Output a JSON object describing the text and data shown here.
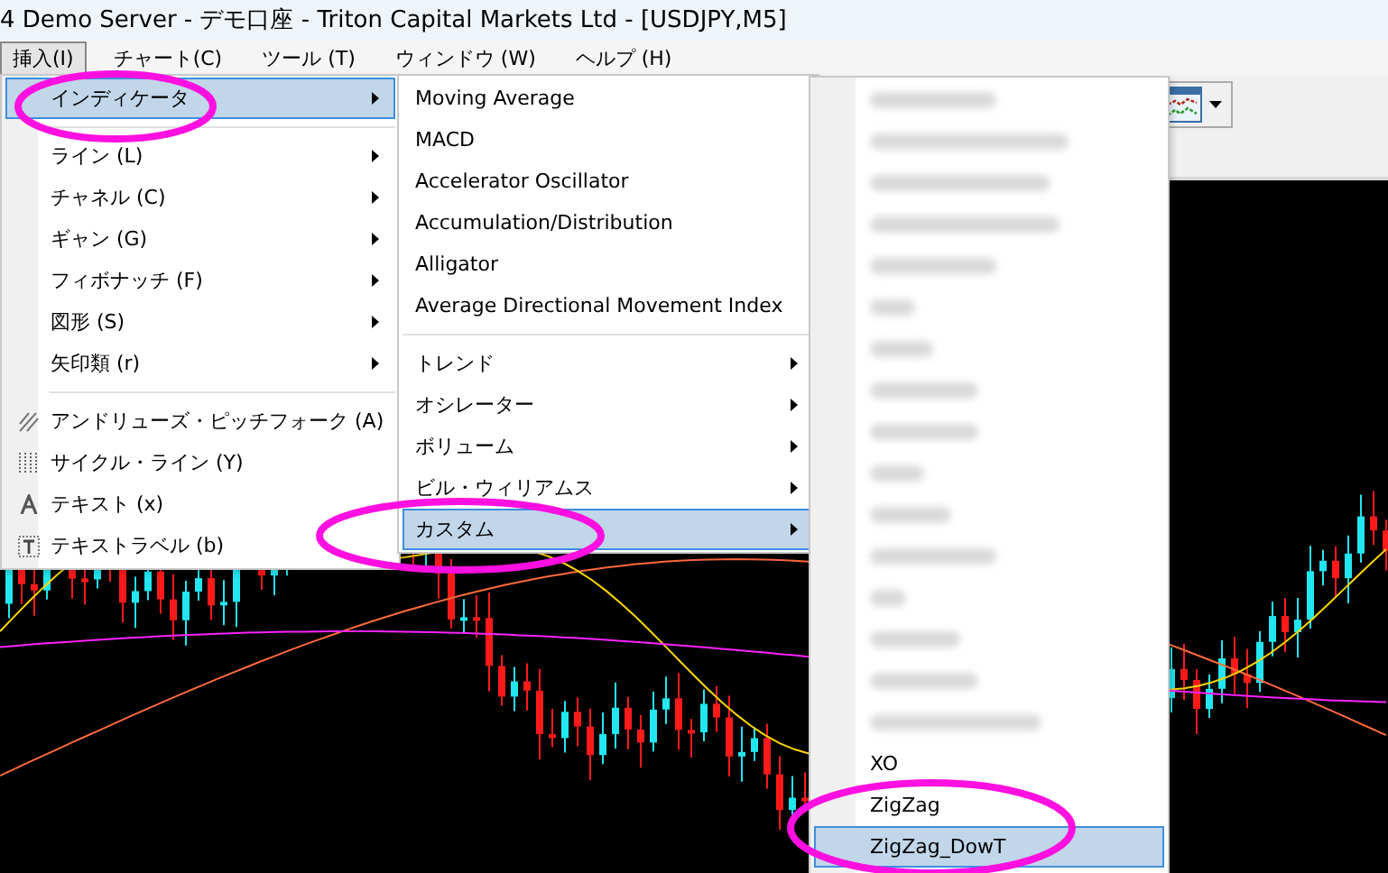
{
  "window": {
    "title": "4 Demo Server - デモ口座 - Triton Capital Markets Ltd - [USDJPY,M5]"
  },
  "menu_bar": [
    {
      "label": "挿入(I)",
      "selected": true
    },
    {
      "label": "チャート(C)",
      "selected": false
    },
    {
      "label": "ツール (T)",
      "selected": false
    },
    {
      "label": "ウィンドウ (W)",
      "selected": false
    },
    {
      "label": "ヘルプ (H)",
      "selected": false
    }
  ],
  "insert_menu": [
    {
      "kind": "submenus",
      "items": [
        {
          "label": "インディケータ",
          "selected": true
        }
      ]
    },
    {
      "kind": "submenus",
      "items": [
        {
          "label": "ライン (L)",
          "selected": false
        },
        {
          "label": "チャネル (C)",
          "selected": false
        },
        {
          "label": "ギャン (G)",
          "selected": false
        },
        {
          "label": "フィボナッチ (F)",
          "selected": false
        },
        {
          "label": "図形 (S)",
          "selected": false
        },
        {
          "label": "矢印類 (r)",
          "selected": false
        }
      ]
    },
    {
      "kind": "tools",
      "items": [
        {
          "label": "アンドリューズ・ピッチフォーク (A)",
          "selected": false
        },
        {
          "label": "サイクル・ライン (Y)",
          "selected": false
        },
        {
          "label": "テキスト (x)",
          "selected": false
        },
        {
          "label": "テキストラベル (b)",
          "selected": false
        }
      ]
    }
  ],
  "indicators_menu": [
    {
      "kind": "plain",
      "items": [
        {
          "label": "Moving Average",
          "selected": false
        },
        {
          "label": "MACD",
          "selected": false
        },
        {
          "label": "Accelerator Oscillator",
          "selected": false
        },
        {
          "label": "Accumulation/Distribution",
          "selected": false
        },
        {
          "label": "Alligator",
          "selected": false
        },
        {
          "label": "Average Directional Movement Index",
          "selected": false
        }
      ]
    },
    {
      "kind": "submenus",
      "items": [
        {
          "label": "トレンド",
          "selected": false
        },
        {
          "label": "オシレーター",
          "selected": false
        },
        {
          "label": "ボリューム",
          "selected": false
        },
        {
          "label": "ビル・ウィリアムス",
          "selected": false
        },
        {
          "label": "カスタム",
          "selected": true
        }
      ]
    }
  ],
  "custom_menu": [
    {
      "blurred": true
    },
    {
      "blurred": true
    },
    {
      "blurred": true
    },
    {
      "blurred": true
    },
    {
      "blurred": true
    },
    {
      "blurred": true
    },
    {
      "blurred": true
    },
    {
      "blurred": true
    },
    {
      "blurred": true
    },
    {
      "blurred": true
    },
    {
      "blurred": true
    },
    {
      "blurred": true
    },
    {
      "blurred": true
    },
    {
      "blurred": true
    },
    {
      "blurred": true
    },
    {
      "blurred": true
    },
    {
      "blurred": false,
      "label": "XO",
      "selected": false
    },
    {
      "blurred": false,
      "label": "ZigZag",
      "selected": false
    },
    {
      "blurred": false,
      "label": "ZigZag_DowT",
      "selected": true
    }
  ]
}
